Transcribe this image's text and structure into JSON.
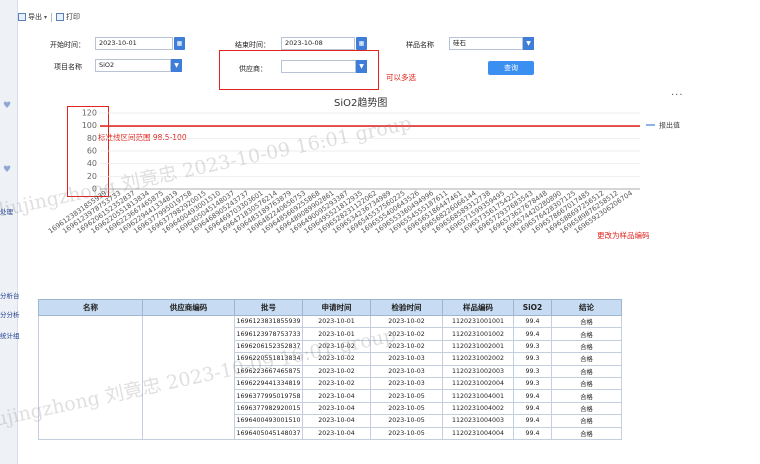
{
  "toolbar": {
    "export_label": "导出",
    "print_label": "打印"
  },
  "left_rail": {
    "items": [
      "处理",
      "分析台",
      "分分析",
      "统计组"
    ]
  },
  "filters": {
    "start_time_label": "开始时间：",
    "start_time_value": "2023-10-01",
    "end_time_label": "结束时间：",
    "end_time_value": "2023-10-08",
    "sample_name_label": "样品名称",
    "sample_name_value": "硅石",
    "item_name_label": "项目名称",
    "item_name_value": "SiO2",
    "supplier_label": "供应商：",
    "supplier_value": "",
    "query_label": "查询"
  },
  "annotations": {
    "multi_select": "可以多选",
    "range_note": "标准线区间范围 98.5-100",
    "axis_note": "更改为样品编码"
  },
  "chart": {
    "more": "···",
    "legend_label": "报出值"
  },
  "chart_data": {
    "type": "line",
    "title": "SiO2趋势图",
    "ylim": [
      0,
      120
    ],
    "yticks": [
      0,
      20,
      40,
      60,
      80,
      100,
      120
    ],
    "reference_lines": [
      98.5,
      100
    ],
    "series": [
      {
        "name": "报出值",
        "color": "#3e7ed8"
      }
    ],
    "categories": [
      "1696123831855939",
      "1696123978753733",
      "1696206152352837",
      "1696220551813834",
      "1696223667465875",
      "1696229441334819",
      "1696377995019758",
      "1696377982920015",
      "1696400493001510",
      "1696405045148037",
      "1696468905243737",
      "1696469703303601",
      "1696471830576214",
      "1696483189763879",
      "1696482240656753",
      "1696485669255868",
      "1696489089902861",
      "1696490095293387",
      "1696495521812935",
      "1696528231122062",
      "1696534236734989",
      "1696545537560225",
      "1696555400643526",
      "1696553360494996",
      "1696554555187611",
      "1696565186447461",
      "1696568226066144",
      "1696568589312738",
      "1696571599359495",
      "1696573561754221",
      "1696572937683543",
      "1696573627678448",
      "1696574420280890",
      "1696576428307125",
      "1696578667017485",
      "1696588697256512",
      "1696589876258512",
      "1696592306206704"
    ]
  },
  "table": {
    "headers": [
      "名称",
      "供应商编码",
      "批号",
      "申请时间",
      "检验时间",
      "样品编码",
      "SiO2",
      "结论"
    ],
    "rows": [
      [
        "1696123831855939",
        "2023-10-01",
        "2023-10-02",
        "1120231001001",
        "99.4",
        "合格"
      ],
      [
        "1696123978753733",
        "2023-10-01",
        "2023-10-02",
        "1120231001002",
        "99.4",
        "合格"
      ],
      [
        "1696206152352837",
        "2023-10-02",
        "2023-10-02",
        "1120231002001",
        "99.3",
        "合格"
      ],
      [
        "1696220551813834",
        "2023-10-02",
        "2023-10-03",
        "1120231002002",
        "99.3",
        "合格"
      ],
      [
        "1696223667465875",
        "2023-10-02",
        "2023-10-03",
        "1120231002003",
        "99.3",
        "合格"
      ],
      [
        "1696229441334819",
        "2023-10-02",
        "2023-10-03",
        "1120231002004",
        "99.3",
        "合格"
      ],
      [
        "1696377995019758",
        "2023-10-04",
        "2023-10-05",
        "1120231004001",
        "99.4",
        "合格"
      ],
      [
        "1696377982920015",
        "2023-10-04",
        "2023-10-05",
        "1120231004002",
        "99.4",
        "合格"
      ],
      [
        "1696400493001510",
        "2023-10-04",
        "2023-10-05",
        "1120231004003",
        "99.4",
        "合格"
      ],
      [
        "1696405045148037",
        "2023-10-04",
        "2023-10-05",
        "1120231004004",
        "99.4",
        "合格"
      ]
    ]
  },
  "watermark": {
    "text": "liujingzhong 刘竟忠 2023-10-09 16:01 group"
  }
}
